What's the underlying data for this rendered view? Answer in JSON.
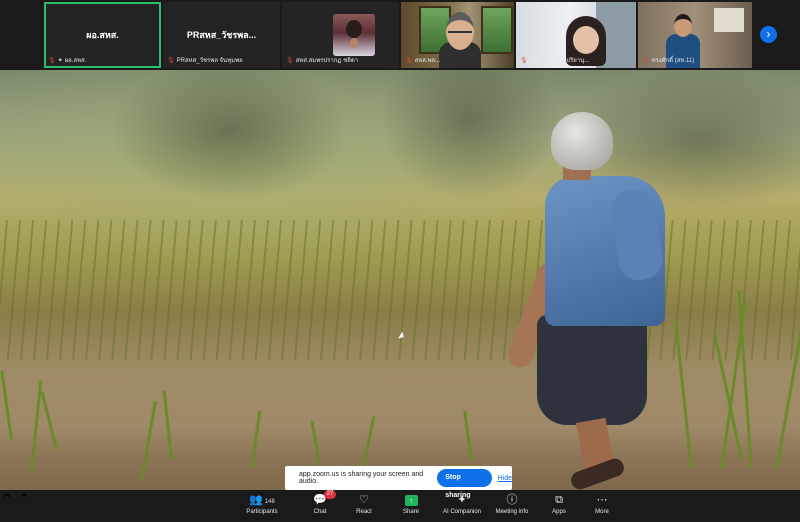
{
  "participants": [
    {
      "display_name": "ผอ.สหส.",
      "label": "ผอ.สหส.",
      "active": true,
      "video": false
    },
    {
      "display_name": "PRสหส_วัชรพล...",
      "label": "PRสหส_วัชรพล จันทุมพล",
      "active": false,
      "video": false
    },
    {
      "display_name": "",
      "label": "สหส.สมพรปรากฏ ชลิดา",
      "active": false,
      "video": true
    },
    {
      "display_name": "",
      "label": "สหส.พล...",
      "active": false,
      "video": true
    },
    {
      "display_name": "",
      "label": "ทสจ.ภากนต์ร ปริยานุ...",
      "active": false,
      "video": true
    },
    {
      "display_name": "",
      "label": "ทรงศักดิ์ (สห.11)",
      "active": false,
      "video": true
    }
  ],
  "next_page_icon": "chevron-right-icon",
  "share_notice": {
    "message": "app.zoom.us is sharing your screen and audio.",
    "stop_label": "Stop sharing",
    "hide_label": "Hide"
  },
  "toolbar": {
    "participants": {
      "label": "Participants",
      "count": "148",
      "icon": "participants-icon"
    },
    "chat": {
      "label": "Chat",
      "badge": "27",
      "icon": "chat-icon"
    },
    "react": {
      "label": "React",
      "icon": "heart-icon"
    },
    "share": {
      "label": "Share",
      "icon": "share-screen-icon"
    },
    "ai": {
      "label": "AI Companion",
      "icon": "sparkle-icon"
    },
    "info": {
      "label": "Meeting info",
      "icon": "info-icon"
    },
    "apps": {
      "label": "Apps",
      "icon": "apps-icon"
    },
    "more": {
      "label": "More",
      "icon": "more-icon"
    }
  },
  "colors": {
    "accent": "#0e71eb",
    "active_border": "#2dbd6e",
    "muted_mic": "#e0463d",
    "badge": "#e02f3c",
    "share_green": "#1db45b"
  }
}
